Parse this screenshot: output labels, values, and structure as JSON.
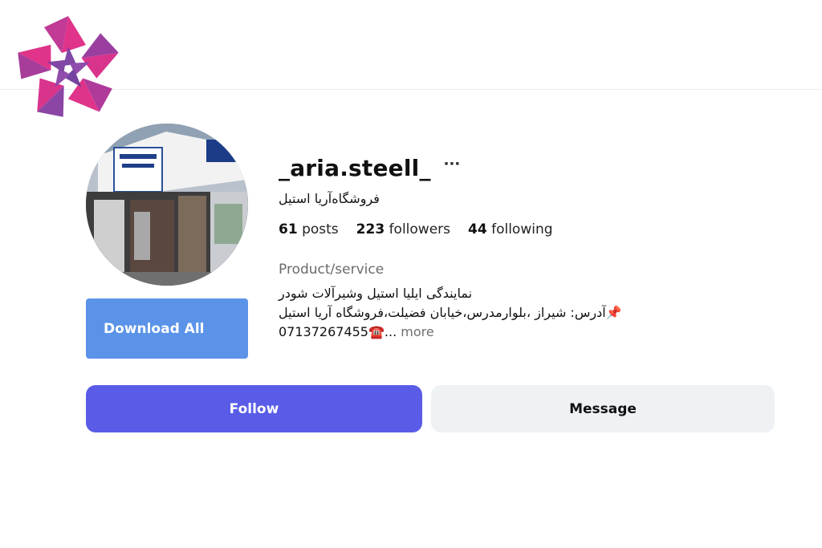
{
  "logo": {
    "icon": "flower-logo-icon",
    "colors": [
      "#e0338a",
      "#7a3fa0",
      "#b5337f"
    ]
  },
  "profile": {
    "avatar_icon": "storefront-photo",
    "username": "_aria.steell_",
    "more_label": "···",
    "full_name": "فروشگاه‌آریا استیل",
    "stats": {
      "posts_count": "61",
      "posts_label": "posts",
      "followers_count": "223",
      "followers_label": "followers",
      "following_count": "44",
      "following_label": "following"
    },
    "category": "Product/service",
    "bio": {
      "line1": "نمایندگی ایلیا استیل وشیرآلات شودر",
      "line2": "📌آدرس: شیراز ،بلوارمدرس،خیابان فضیلت،فروشگاه آریا استیل",
      "line3": "07137267455☎️...",
      "more_label": "more"
    }
  },
  "actions": {
    "download_all": "Download All",
    "follow": "Follow",
    "message": "Message"
  },
  "colors": {
    "download_button": "#5b93e9",
    "follow_button": "#5a5ce8",
    "message_button": "#eff2f5",
    "category_text": "#6b6b6b"
  }
}
